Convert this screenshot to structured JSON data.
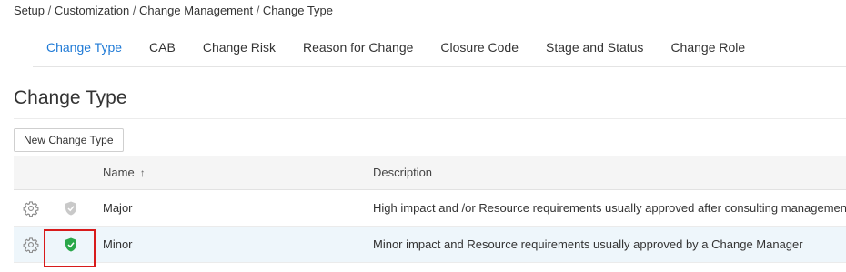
{
  "breadcrumb": [
    "Setup",
    "Customization",
    "Change Management",
    "Change Type"
  ],
  "tabs": [
    {
      "label": "Change Type",
      "active": true
    },
    {
      "label": "CAB"
    },
    {
      "label": "Change Risk"
    },
    {
      "label": "Reason for Change"
    },
    {
      "label": "Closure Code"
    },
    {
      "label": "Stage and Status"
    },
    {
      "label": "Change Role"
    }
  ],
  "page": {
    "title": "Change Type",
    "new_button_label": "New Change Type"
  },
  "table": {
    "columns": {
      "name": "Name",
      "name_sort": "↑",
      "description": "Description"
    },
    "rows": [
      {
        "name": "Major",
        "description": "High impact and /or Resource requirements usually approved after consulting management",
        "default": false
      },
      {
        "name": "Minor",
        "description": "Minor impact and Resource requirements usually approved by a Change Manager",
        "default": true
      }
    ]
  },
  "colors": {
    "accent": "#1f7ad6",
    "default_shield": "#2aa74a",
    "inactive_shield": "#c9c9c9",
    "highlight_box": "#d81b1b",
    "row_highlight": "#eef6fb"
  },
  "icons": {
    "gear": "gear-icon",
    "shield": "shield-check-icon"
  }
}
